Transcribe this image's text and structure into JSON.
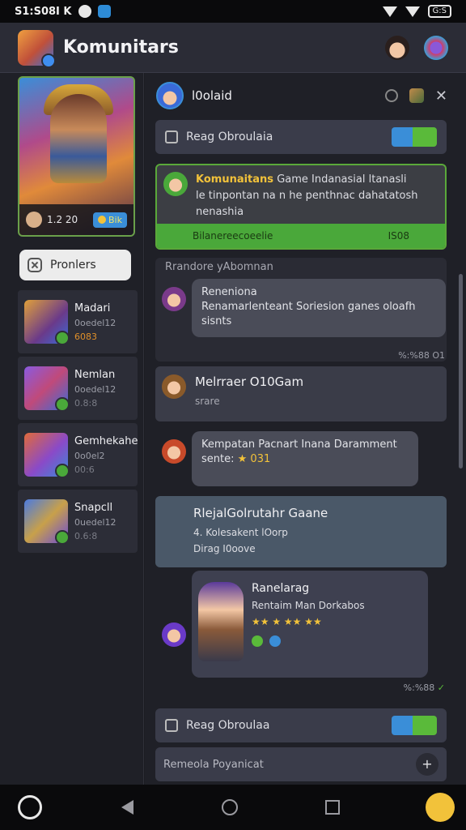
{
  "status_bar": {
    "time": "S1:S08I K",
    "battery": "G:S"
  },
  "app": {
    "title": "Komunitars"
  },
  "sidebar": {
    "hero": {
      "stat": "1.2 20",
      "badge": "Bik"
    },
    "profiles_button": "Pronlers",
    "players": [
      {
        "name": "Madari",
        "sub": "0oedel12",
        "score": "6083"
      },
      {
        "name": "Nemlan",
        "sub": "0oedel12",
        "score": "0.8:8"
      },
      {
        "name": "Gemhekahe",
        "sub": "0o0el2",
        "score": "00:6"
      },
      {
        "name": "Snapcll",
        "sub": "0uedel12",
        "score": "0.6:8"
      }
    ]
  },
  "chat": {
    "header": {
      "title": "l0olaid"
    },
    "reag_bar_1": {
      "label": "Reag Obroulaia"
    },
    "game_card": {
      "title_highlight": "Komunaitans",
      "title_rest": "Game Indanasial ltanasli",
      "line2": "le tinpontan na n he penthnac dahatatosh",
      "line3": "nenashia",
      "footer_left": "Bilanereecoeelie",
      "footer_right": "IS08"
    },
    "section_title": "Rrandore yAbomnan",
    "message_1": {
      "author": "Reneniona",
      "text": "Renamarlenteant Soriesion ganes oloafh",
      "text2": "sisnts",
      "time": "%:%88 O1"
    },
    "message_2": {
      "title": "Melrraer O10Gam",
      "sub": "srare"
    },
    "message_3": {
      "text": "Kempatan Pacnart Inana Daramment",
      "text2": "sente:",
      "stars": "★ 031"
    },
    "message_4": {
      "title": "RlejalGolrutahr Gaane",
      "line1": "4. Kolesakent lOorp",
      "line2": "Dirag I0oove"
    },
    "message_5": {
      "title": "Ranelarag",
      "sub": "Rentaim Man Dorkabos",
      "stars": "★★ ★ ★★ ★★",
      "time": "%:%88"
    },
    "reag_bar_2": {
      "label": "Reag Obroulaa"
    },
    "input": {
      "placeholder": "Remeola Poyanicat"
    }
  }
}
